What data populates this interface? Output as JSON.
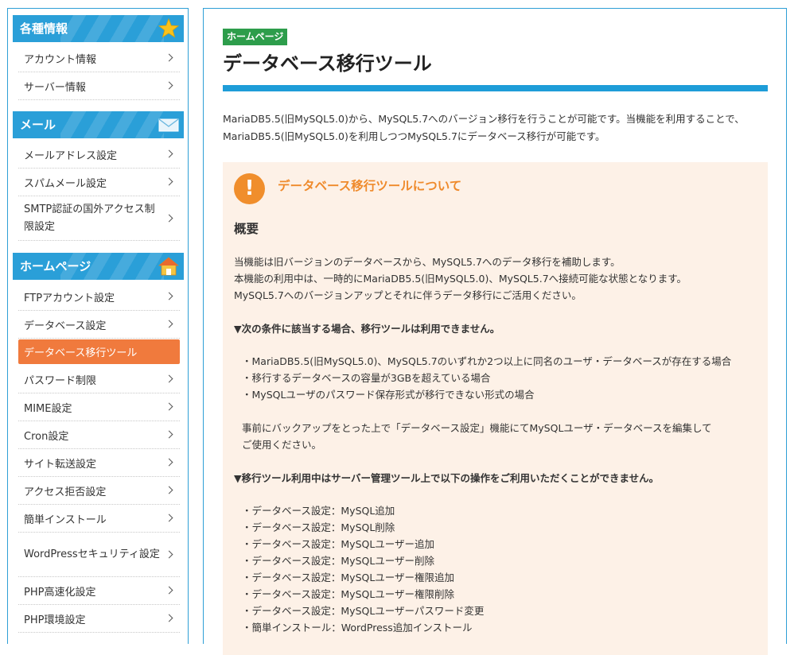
{
  "sidebar": {
    "section_info": {
      "title": "各種情報",
      "icon": "star-icon",
      "items": [
        {
          "label": "アカウント情報"
        },
        {
          "label": "サーバー情報"
        }
      ]
    },
    "section_mail": {
      "title": "メール",
      "icon": "mail-icon",
      "items": [
        {
          "label": "メールアドレス設定"
        },
        {
          "label": "スパムメール設定"
        },
        {
          "label": "SMTP認証の国外アクセス制限設定"
        }
      ]
    },
    "section_home": {
      "title": "ホームページ",
      "icon": "house-icon",
      "items": [
        {
          "label": "FTPアカウント設定"
        },
        {
          "label": "データベース設定"
        },
        {
          "label": "データベース移行ツール",
          "active": true
        },
        {
          "label": "パスワード制限"
        },
        {
          "label": "MIME設定"
        },
        {
          "label": "Cron設定"
        },
        {
          "label": "サイト転送設定"
        },
        {
          "label": "アクセス拒否設定"
        },
        {
          "label": "簡単インストール"
        },
        {
          "label": "WordPressセキュリティ設定"
        },
        {
          "label": "PHP高速化設定"
        },
        {
          "label": "PHP環境設定"
        }
      ]
    }
  },
  "main": {
    "badge": "ホームページ",
    "title": "データベース移行ツール",
    "intro": "MariaDB5.5(旧MySQL5.0)から、MySQL5.7へのバージョン移行を行うことが可能です。当機能を利用することで、MariaDB5.5(旧MySQL5.0)を利用しつつMySQL5.7にデータベース移行が可能です。",
    "notice": {
      "icon": "exclamation-icon",
      "title": "データベース移行ツールについて",
      "subtitle": "概要",
      "overview": [
        "当機能は旧バージョンのデータベースから、MySQL5.7へのデータ移行を補助します。",
        "本機能の利用中は、一時的にMariaDB5.5(旧MySQL5.0)、MySQL5.7へ接続可能な状態となります。",
        "MySQL5.7へのバージョンアップとそれに伴うデータ移行にご活用ください。"
      ],
      "cond_heading": "▼次の条件に該当する場合、移行ツールは利用できません。",
      "cond_items": [
        "MariaDB5.5(旧MySQL5.0)、MySQL5.7のいずれか2つ以上に同名のユーザ・データベースが存在する場合",
        "移行するデータベースの容量が3GBを超えている場合",
        "MySQLユーザのパスワード保存形式が移行できない形式の場合"
      ],
      "backup_note": [
        "事前にバックアップをとった上で「データベース設定」機能にてMySQLユーザ・データベースを編集して",
        "ご使用ください。"
      ],
      "ops_heading": "▼移行ツール利用中はサーバー管理ツール上で以下の操作をご利用いただくことができません。",
      "ops_items": [
        "データベース設定：MySQL追加",
        "データベース設定：MySQL削除",
        "データベース設定：MySQLユーザー追加",
        "データベース設定：MySQLユーザー削除",
        "データベース設定：MySQLユーザー権限追加",
        "データベース設定：MySQLユーザー権限削除",
        "データベース設定：MySQLユーザーパスワード変更",
        "簡単インストール：WordPress追加インストール"
      ]
    }
  },
  "colors": {
    "accent_blue": "#2a9fd8",
    "active_orange": "#f07a3d",
    "badge_green": "#2d9d4b",
    "notice_bg": "#fdf1e7",
    "notice_title": "#ef8a2b"
  }
}
